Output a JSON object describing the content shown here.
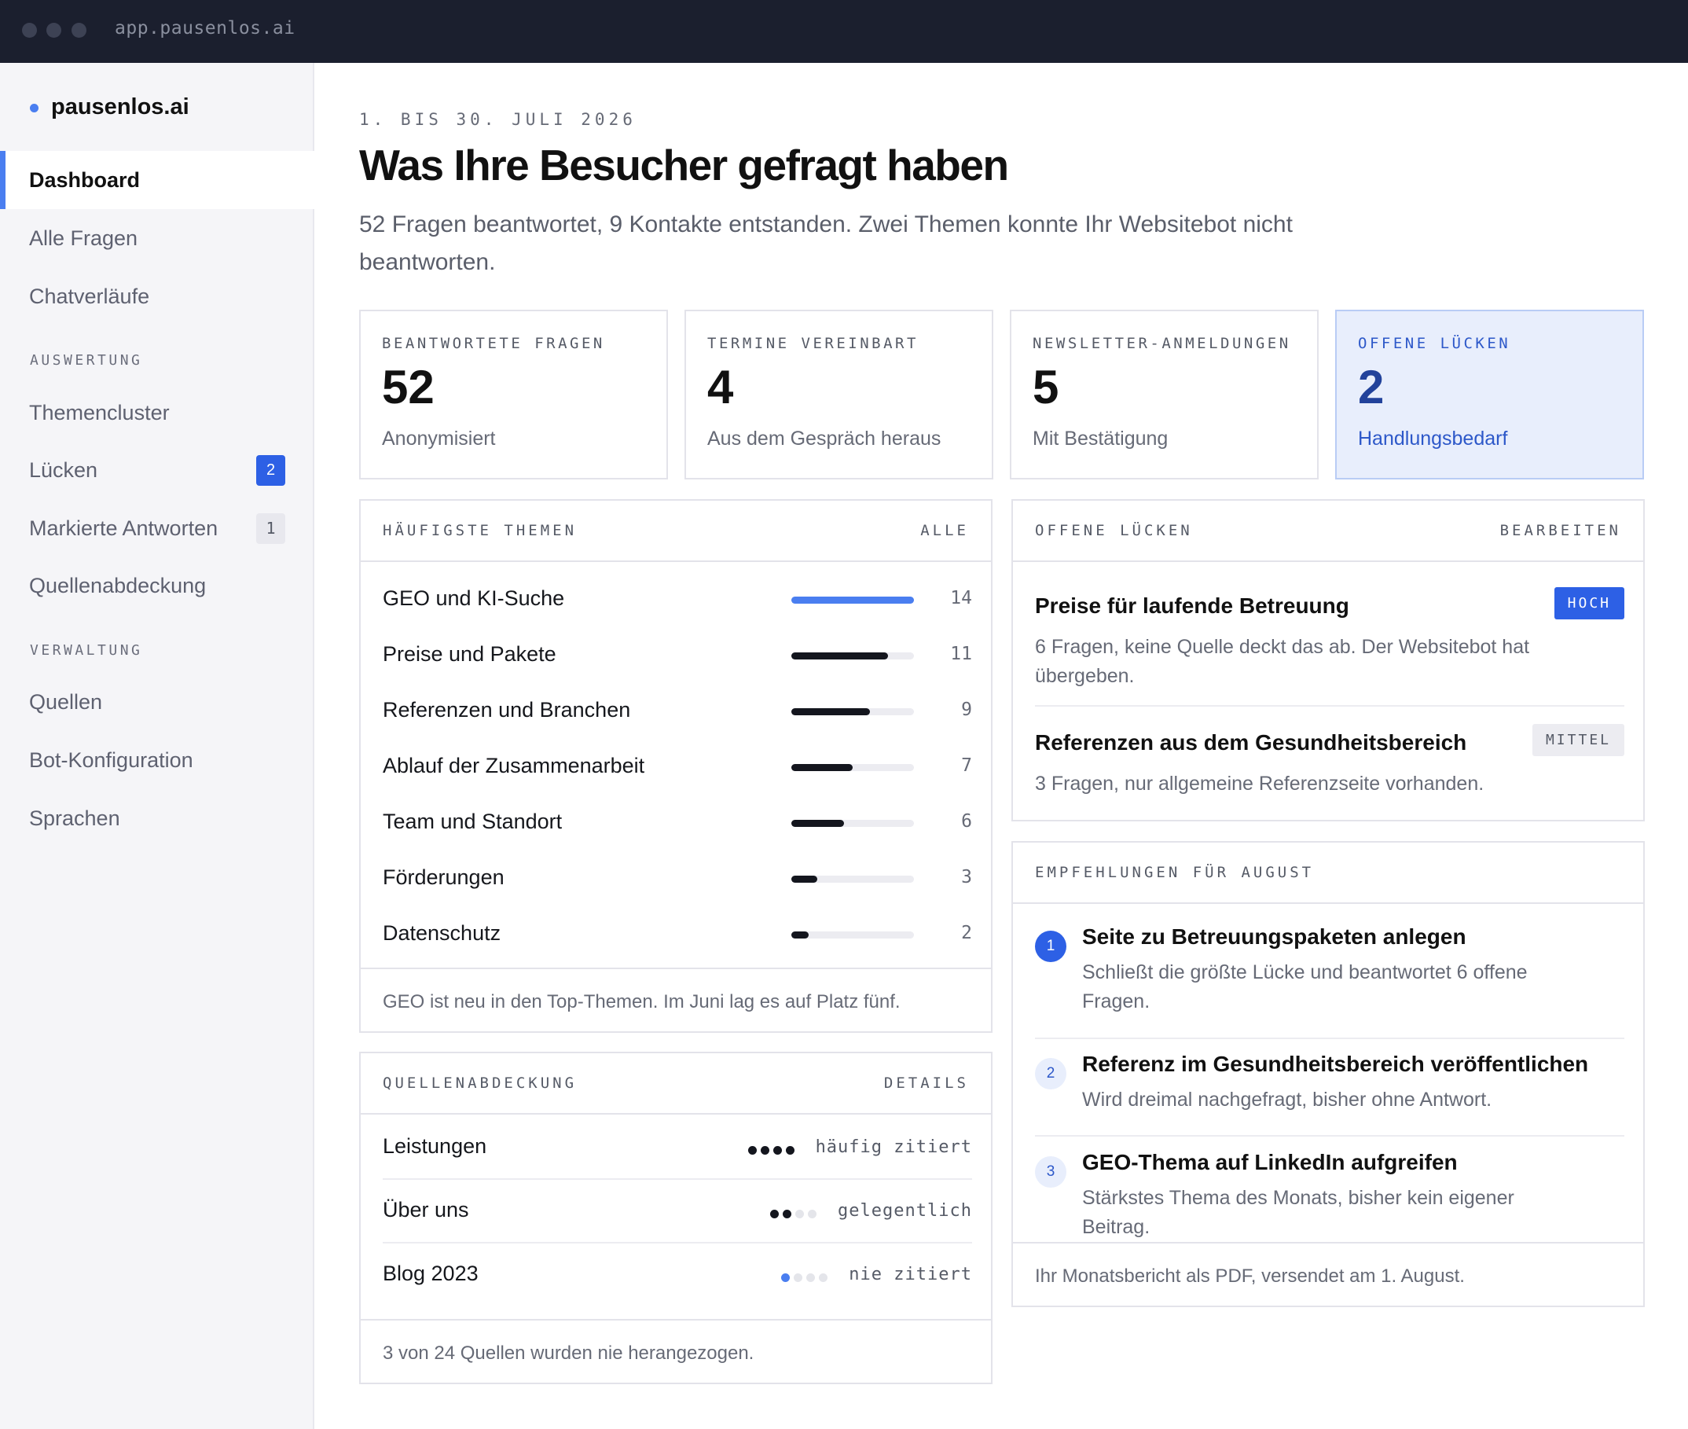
{
  "browser": {
    "url": "app.pausenlos.ai"
  },
  "sidebar": {
    "brand": "pausenlos.ai",
    "items_top": [
      {
        "label": "Dashboard",
        "active": true
      },
      {
        "label": "Alle Fragen"
      },
      {
        "label": "Chatverläufe"
      }
    ],
    "section_auswertung": "AUSWERTUNG",
    "items_auswertung": [
      {
        "label": "Themencluster"
      },
      {
        "label": "Lücken",
        "badge": "2"
      },
      {
        "label": "Markierte Antworten",
        "badge": "1"
      },
      {
        "label": "Quellenabdeckung"
      }
    ],
    "section_verwaltung": "VERWALTUNG",
    "items_verwaltung": [
      {
        "label": "Quellen"
      },
      {
        "label": "Bot-Konfiguration"
      },
      {
        "label": "Sprachen"
      }
    ]
  },
  "header": {
    "date_range": "1. BIS 30. JULI 2026",
    "title": "Was Ihre Besucher gefragt haben",
    "subtitle": "52 Fragen beantwortet, 9 Kontakte entstanden. Zwei Themen konnte Ihr Websitebot nicht beantworten."
  },
  "stats": [
    {
      "label": "BEANTWORTETE FRAGEN",
      "value": "52",
      "sub": "Anonymisiert"
    },
    {
      "label": "TERMINE VEREINBART",
      "value": "4",
      "sub": "Aus dem Gespräch heraus"
    },
    {
      "label": "NEWSLETTER-ANMELDUNGEN",
      "value": "5",
      "sub": "Mit Bestätigung"
    },
    {
      "label": "OFFENE LÜCKEN",
      "value": "2",
      "sub": "Handlungsbedarf"
    }
  ],
  "topics": {
    "heading": "HÄUFIGSTE THEMEN",
    "action": "ALLE",
    "max": 14,
    "items": [
      {
        "label": "GEO und KI-Suche",
        "count": 14,
        "highlight": true
      },
      {
        "label": "Preise und Pakete",
        "count": 11
      },
      {
        "label": "Referenzen und Branchen",
        "count": 9
      },
      {
        "label": "Ablauf der Zusammenarbeit",
        "count": 7
      },
      {
        "label": "Team und Standort",
        "count": 6
      },
      {
        "label": "Förderungen",
        "count": 3
      },
      {
        "label": "Datenschutz",
        "count": 2
      }
    ],
    "footer": "GEO ist neu in den Top-Themen. Im Juni lag es auf Platz fünf."
  },
  "sources": {
    "heading": "QUELLENABDECKUNG",
    "action": "DETAILS",
    "items": [
      {
        "label": "Leistungen",
        "status": "häufig zitiert",
        "level": 4
      },
      {
        "label": "Über uns",
        "status": "gelegentlich",
        "level": 2
      },
      {
        "label": "Blog 2023",
        "status": "nie zitiert",
        "level": 0
      }
    ],
    "footer": "3 von 24 Quellen wurden nie herangezogen."
  },
  "gaps": {
    "heading": "OFFENE LÜCKEN",
    "action": "BEARBEITEN",
    "items": [
      {
        "title": "Preise für laufende Betreuung",
        "desc": "6 Fragen, keine Quelle deckt das ab. Der Websitebot hat übergeben.",
        "priority": "HOCH"
      },
      {
        "title": "Referenzen aus dem Gesundheitsbereich",
        "desc": "3 Fragen, nur allgemeine Referenzseite vorhanden.",
        "priority": "MITTEL"
      }
    ]
  },
  "recommendations": {
    "heading": "EMPFEHLUNGEN FÜR AUGUST",
    "items": [
      {
        "n": "1",
        "title": "Seite zu Betreuungspaketen anlegen",
        "desc": "Schließt die größte Lücke und beantwortet 6 offene Fragen."
      },
      {
        "n": "2",
        "title": "Referenz im Gesundheitsbereich veröffentlichen",
        "desc": "Wird dreimal nachgefragt, bisher ohne Antwort."
      },
      {
        "n": "3",
        "title": "GEO-Thema auf LinkedIn aufgreifen",
        "desc": "Stärkstes Thema des Monats, bisher kein eigener Beitrag."
      }
    ],
    "footer": "Ihr Monatsbericht als PDF, versendet am 1. August."
  },
  "colors": {
    "accent": "#2d60e5",
    "accent_light": "#4a7ef0",
    "chrome": "#1b1f2e",
    "highlight_bg": "#e8eefc"
  }
}
